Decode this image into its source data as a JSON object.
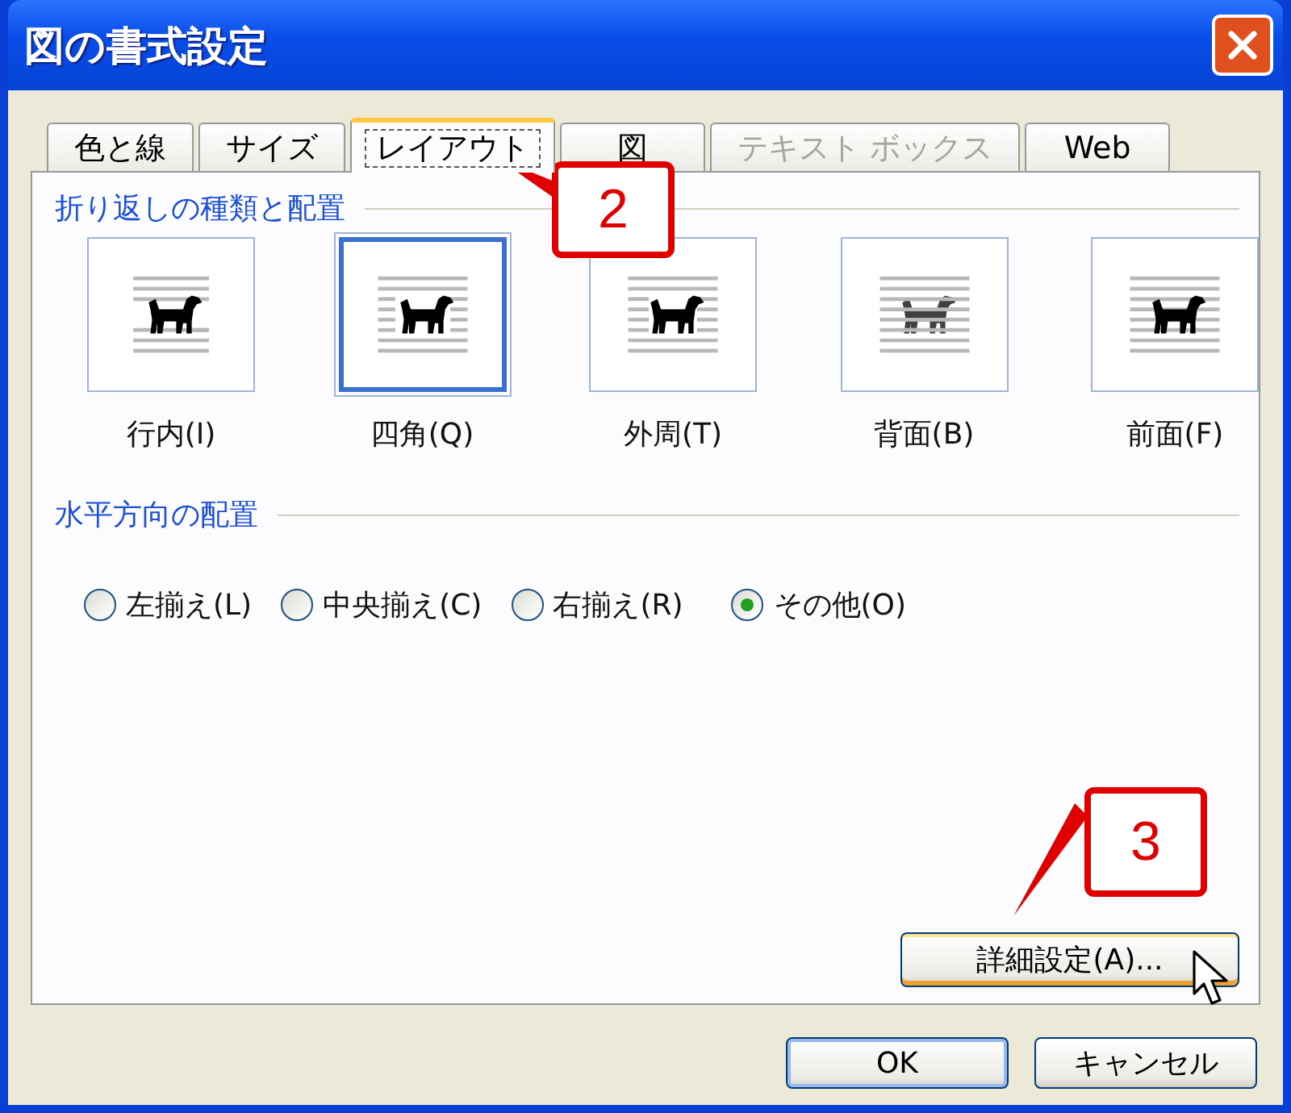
{
  "window": {
    "title": "図の書式設定"
  },
  "tabs": [
    {
      "label": "色と線",
      "selected": false,
      "disabled": false
    },
    {
      "label": "サイズ",
      "selected": false,
      "disabled": false
    },
    {
      "label": "レイアウト",
      "selected": true,
      "disabled": false
    },
    {
      "label": "図",
      "selected": false,
      "disabled": false
    },
    {
      "label": "テキスト ボックス",
      "selected": false,
      "disabled": true
    },
    {
      "label": "Web",
      "selected": false,
      "disabled": false
    }
  ],
  "wrapping": {
    "heading": "折り返しの種類と配置",
    "options": [
      {
        "kind": "inline",
        "label": "行内(I)",
        "selected": false
      },
      {
        "kind": "square",
        "label": "四角(Q)",
        "selected": true
      },
      {
        "kind": "tight",
        "label": "外周(T)",
        "selected": false
      },
      {
        "kind": "behind",
        "label": "背面(B)",
        "selected": false
      },
      {
        "kind": "front",
        "label": "前面(F)",
        "selected": false
      }
    ]
  },
  "alignment": {
    "heading": "水平方向の配置",
    "options": [
      {
        "label": "左揃え(L)",
        "selected": false
      },
      {
        "label": "中央揃え(C)",
        "selected": false
      },
      {
        "label": "右揃え(R)",
        "selected": false
      },
      {
        "label": "その他(O)",
        "selected": true
      }
    ]
  },
  "advanced_button": "詳細設定(A)...",
  "buttons": [
    "OK",
    "キャンセル"
  ],
  "callouts": [
    {
      "text": "2"
    },
    {
      "text": "3"
    }
  ]
}
